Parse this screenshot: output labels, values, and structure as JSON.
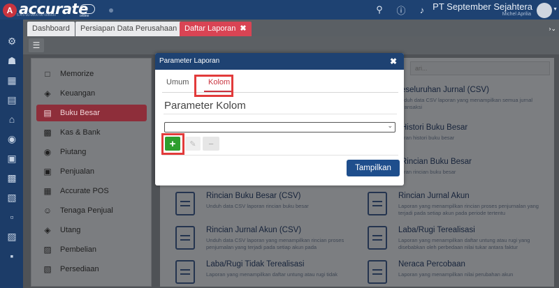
{
  "app": {
    "logo_letter": "A",
    "logo_text": "accurate",
    "logo_sub": "5.4.5 00-0000 00 000000",
    "logo_online": "online",
    "company": "PT September Sejahtera",
    "user": "Michel Aprilia"
  },
  "tabs": [
    {
      "label": "Dashboard"
    },
    {
      "label": "Persiapan Data Perusahaan"
    },
    {
      "label": "Daftar Laporan",
      "close": "✖"
    }
  ],
  "menu": [
    {
      "label": "Memorize",
      "icon": "save-icon"
    },
    {
      "label": "Keuangan",
      "icon": "finance-icon"
    },
    {
      "label": "Buku Besar",
      "icon": "ledger-icon"
    },
    {
      "label": "Kas & Bank",
      "icon": "bank-icon"
    },
    {
      "label": "Piutang",
      "icon": "receivable-icon"
    },
    {
      "label": "Penjualan",
      "icon": "cart-icon"
    },
    {
      "label": "Accurate POS",
      "icon": "pos-icon"
    },
    {
      "label": "Tenaga Penjual",
      "icon": "salesperson-icon"
    },
    {
      "label": "Utang",
      "icon": "payable-icon"
    },
    {
      "label": "Pembelian",
      "icon": "purchase-icon"
    },
    {
      "label": "Persediaan",
      "icon": "inventory-icon"
    }
  ],
  "search": {
    "placeholder": "ari..."
  },
  "reports": [
    {
      "title": "eseluruhan Jurnal (CSV)",
      "desc": "nduh data CSV laporan yang menampilkan semua jurnal transaksi"
    },
    {
      "title": "Histori Buku Besar",
      "desc": "oran histori buku besar"
    },
    {
      "title": "Rincian Buku Besar",
      "desc": "oran rincian buku besar"
    },
    {
      "title": "Rincian Buku Besar (CSV)",
      "desc": "Unduh data CSV laporan rincian buku besar"
    },
    {
      "title": "Rincian Jurnal Akun",
      "desc": "Laporan yang menampilkan rincian proses penjurnalan yang terjadi pada setiap akun pada periode tertentu"
    },
    {
      "title": "Rincian Jurnal Akun (CSV)",
      "desc": "Unduh data CSV laporan yang menampilkan rincian proses penjurnalan yang terjadi pada setiap akun pada"
    },
    {
      "title": "Laba/Rugi Terealisasi",
      "desc": "Laporan yang menampilkan daftar untung atau rugi yang disebabkan oleh perbedaan nilai tukar antara faktur"
    },
    {
      "title": "Laba/Rugi Tidak Terealisasi",
      "desc": "Laporan yang menampilkan daftar untung atau rugi tidak"
    },
    {
      "title": "Neraca Percobaan",
      "desc": "Laporan yang menampilkan nilai perubahan akun"
    }
  ],
  "dialog": {
    "title": "Parameter Laporan",
    "close": "✖",
    "tab_general": "Umum",
    "tab_column": "Kolom",
    "section_title": "Parameter Kolom",
    "select_value": "",
    "add_symbol": "+",
    "edit_symbol": "✎",
    "remove_symbol": "−",
    "show_button": "Tampilkan"
  }
}
